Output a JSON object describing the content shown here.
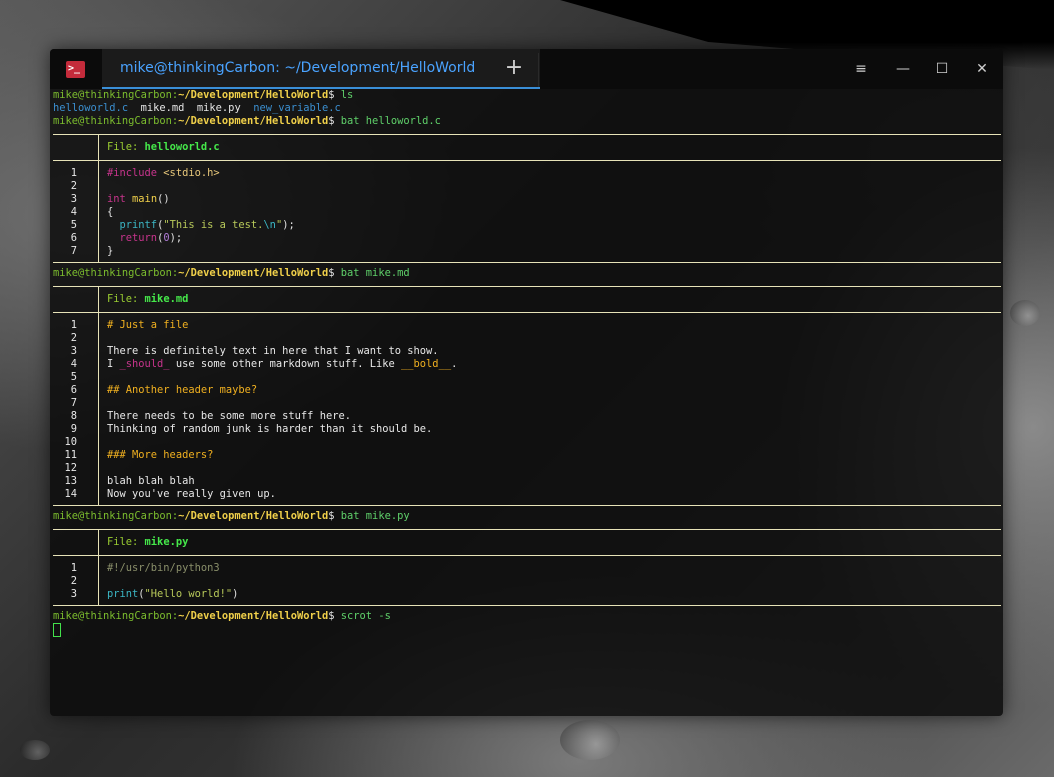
{
  "window": {
    "tab_title": "mike@thinkingCarbon: ~/Development/HelloWorld",
    "new_tab_glyph": "+",
    "controls": {
      "menu": "≡",
      "minimize": "—",
      "maximize": "☐",
      "close": "✕"
    },
    "app_icon": ">_"
  },
  "prompt": {
    "user": "mike@thinkingCarbon",
    "sep": ":",
    "path": "~/Development/HelloWorld",
    "dollar": "$ "
  },
  "commands": {
    "ls": "ls",
    "bat1": "bat helloworld.c",
    "bat2": "bat mike.md",
    "bat3": "bat mike.py",
    "last": "scrot -s"
  },
  "ls_output": {
    "f1": "helloworld.c",
    "f2": "mike.md",
    "f3": "mike.py",
    "f4": "new_variable.c"
  },
  "files": {
    "c": {
      "label": "File: ",
      "name": "helloworld.c",
      "nums": [
        "1",
        "2",
        "3",
        "4",
        "5",
        "6",
        "7"
      ]
    },
    "md": {
      "label": "File: ",
      "name": "mike.md",
      "nums": [
        "1",
        "2",
        "3",
        "4",
        "5",
        "6",
        "7",
        "8",
        "9",
        "10",
        "11",
        "12",
        "13",
        "14"
      ],
      "lines": {
        "l1": "# Just a file",
        "l3": "There is definitely text in here that I want to show.",
        "l4a": "I ",
        "l4b": "_should_",
        "l4c": " use some other markdown stuff. Like ",
        "l4d": "__bold__",
        "l4e": ".",
        "l6": "## Another header maybe?",
        "l8": "There needs to be some more stuff here.",
        "l9": "Thinking of random junk is harder than it should be.",
        "l11": "### More headers?",
        "l13": "blah blah blah",
        "l14": "Now you've really given up."
      }
    },
    "py": {
      "label": "File: ",
      "name": "mike.py",
      "nums": [
        "1",
        "2",
        "3"
      ],
      "lines": {
        "l1": "#!/usr/bin/python3",
        "l3a": "print",
        "l3b": "(",
        "l3c": "\"Hello world!\"",
        "l3d": ")"
      }
    }
  },
  "code_c": {
    "l1a": "#include",
    "l1b": " <stdio.h>",
    "l3a": "int",
    "l3b": " ",
    "l3c": "main",
    "l3d": "()",
    "l4": "{",
    "l5a": "  ",
    "l5b": "printf",
    "l5c": "(",
    "l5d": "\"This is a test.",
    "l5e": "\\n",
    "l5f": "\"",
    "l5g": ");",
    "l6a": "  ",
    "l6b": "return",
    "l6c": "(",
    "l6d": "0",
    "l6e": ");",
    "l7": "}"
  },
  "colors": {
    "accent": "#3a8fd8",
    "prompt_user": "#7cbd2e",
    "prompt_path": "#f0d04a",
    "grid_line": "#e7e3b8",
    "cursor": "#43e14b"
  }
}
